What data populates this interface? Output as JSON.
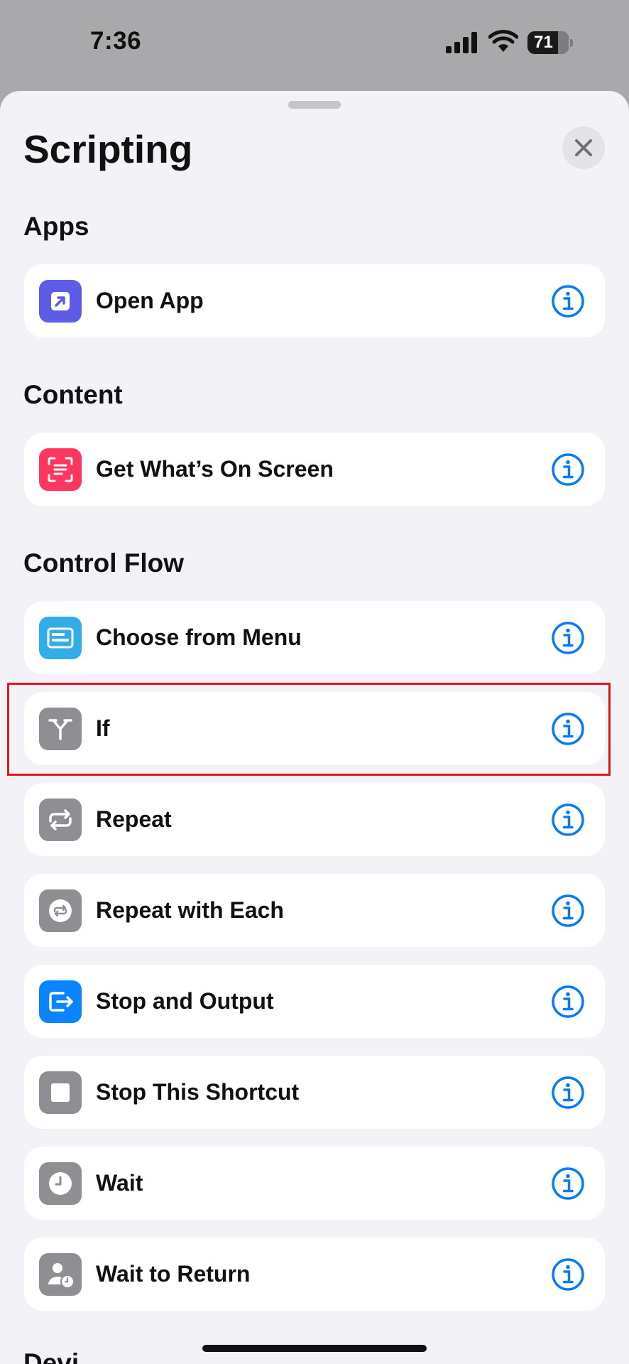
{
  "status_bar": {
    "time": "7:36",
    "battery": "71"
  },
  "sheet": {
    "title": "Scripting",
    "sections": [
      {
        "header": "Apps",
        "items": [
          {
            "label": "Open App",
            "icon": "open-app-icon",
            "color": "#5e5ce6"
          }
        ]
      },
      {
        "header": "Content",
        "items": [
          {
            "label": "Get What’s On Screen",
            "icon": "scan-text-icon",
            "color": "#ff375f"
          }
        ]
      },
      {
        "header": "Control Flow",
        "items": [
          {
            "label": "Choose from Menu",
            "icon": "menu-card-icon",
            "color": "#32ade6"
          },
          {
            "label": "If",
            "icon": "branch-icon",
            "color": "#8e8e93",
            "highlighted": true
          },
          {
            "label": "Repeat",
            "icon": "repeat-icon",
            "color": "#8e8e93"
          },
          {
            "label": "Repeat with Each",
            "icon": "repeat-circle-icon",
            "color": "#8e8e93"
          },
          {
            "label": "Stop and Output",
            "icon": "stop-output-icon",
            "color": "#0a84ff"
          },
          {
            "label": "Stop This Shortcut",
            "icon": "stop-square-icon",
            "color": "#8e8e93"
          },
          {
            "label": "Wait",
            "icon": "clock-icon",
            "color": "#8e8e93"
          },
          {
            "label": "Wait to Return",
            "icon": "person-clock-icon",
            "color": "#8e8e93"
          }
        ]
      },
      {
        "header": "Devi",
        "items": []
      }
    ]
  },
  "colors": {
    "info_blue": "#0a7bf5",
    "highlight_red": "#e0191f"
  }
}
